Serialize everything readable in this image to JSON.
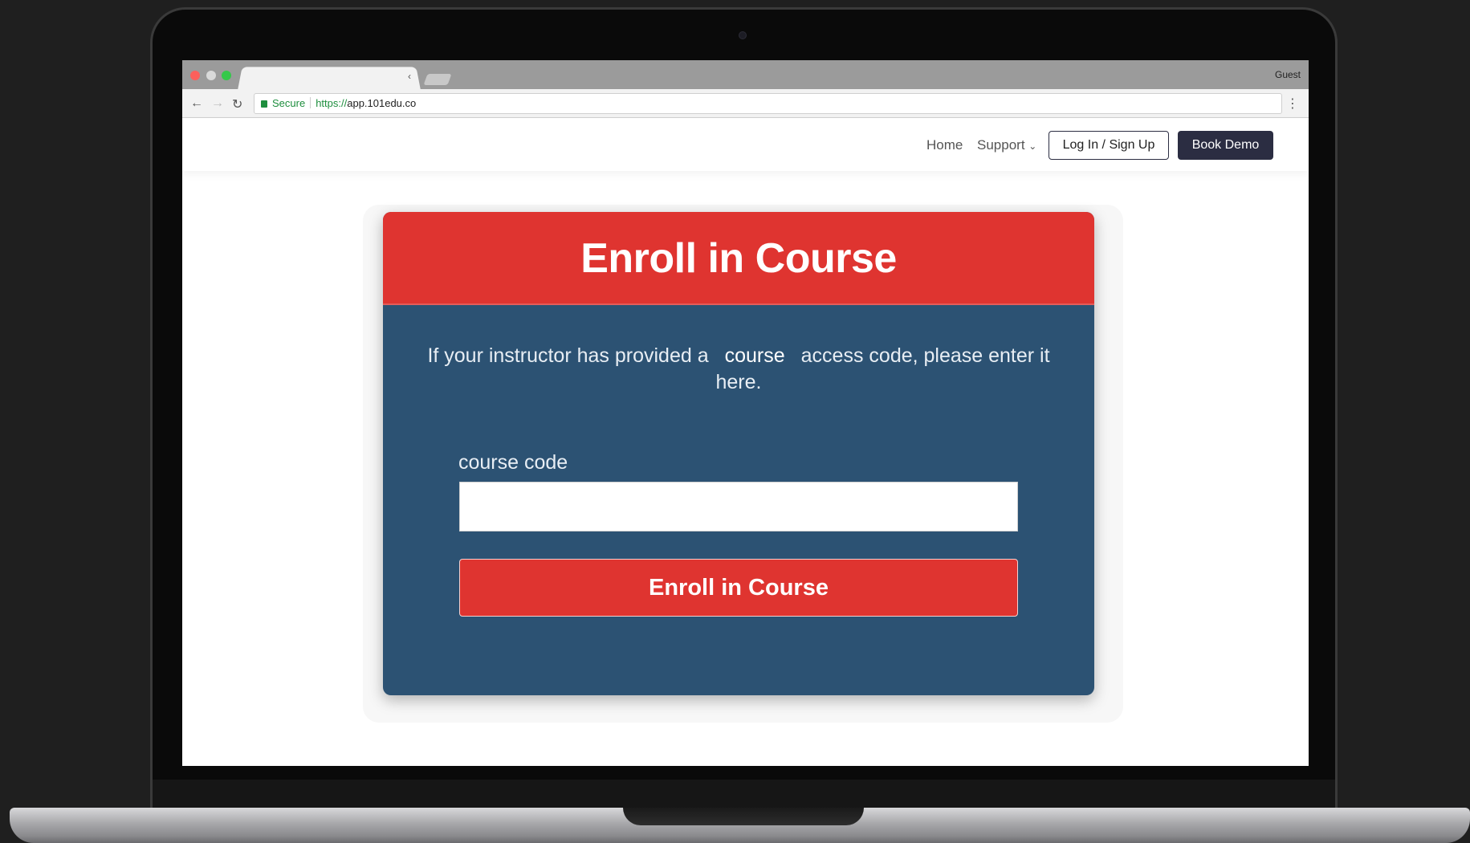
{
  "browser": {
    "profile_label": "Guest",
    "tab_close_glyph": "‹",
    "url": {
      "secure_label": "Secure",
      "scheme": "https://",
      "host": "app.101edu.co"
    }
  },
  "site_nav": {
    "home": "Home",
    "support": "Support",
    "support_chevron": "⌄",
    "login_signup": "Log In / Sign Up",
    "book_demo": "Book Demo"
  },
  "enroll_card": {
    "title": "Enroll in Course",
    "instructions_before": "If your instructor has provided a",
    "instructions_code_word": "course",
    "instructions_after": "access code, please enter it here.",
    "field_label": "course code",
    "input_value": "",
    "submit_label": "Enroll in Course"
  },
  "colors": {
    "header_red": "#df3430",
    "card_blue": "#2c5273",
    "demo_button": "#2b2d42"
  }
}
